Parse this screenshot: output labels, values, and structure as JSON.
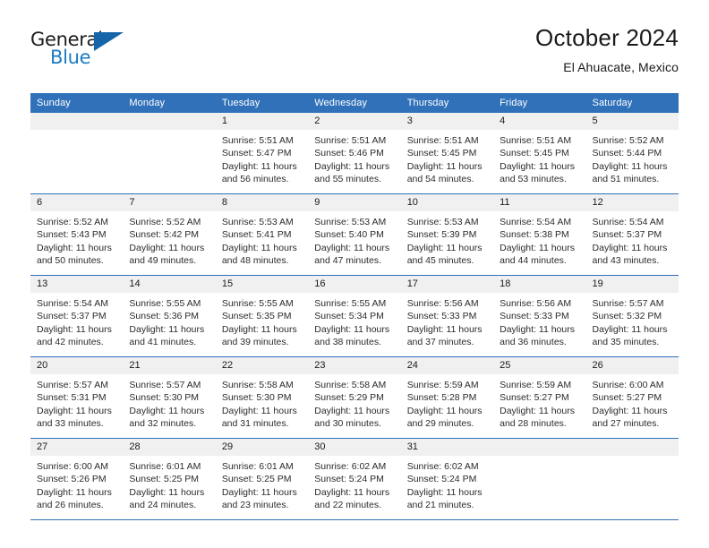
{
  "brand": {
    "name_top": "General",
    "name_bottom": "Blue",
    "triangle_color": "#1565a8",
    "blue_text_color": "#1d7cc4"
  },
  "header": {
    "title": "October 2024",
    "subtitle": "El Ahuacate, Mexico"
  },
  "theme": {
    "header_blue": "#3071b9",
    "date_band_gray": "#f0f0f0",
    "row_separator": "#3071b9",
    "text": "#1a1a1a"
  },
  "calendar": {
    "weekday_headers": [
      "Sunday",
      "Monday",
      "Tuesday",
      "Wednesday",
      "Thursday",
      "Friday",
      "Saturday"
    ],
    "labels": {
      "sunrise": "Sunrise:",
      "sunset": "Sunset:",
      "daylight": "Daylight:"
    },
    "weeks": [
      [
        {
          "day": "",
          "sunrise": "",
          "sunset": "",
          "daylight_line1": "",
          "daylight_line2": ""
        },
        {
          "day": "",
          "sunrise": "",
          "sunset": "",
          "daylight_line1": "",
          "daylight_line2": ""
        },
        {
          "day": "1",
          "sunrise": "Sunrise: 5:51 AM",
          "sunset": "Sunset: 5:47 PM",
          "daylight_line1": "Daylight: 11 hours",
          "daylight_line2": "and 56 minutes."
        },
        {
          "day": "2",
          "sunrise": "Sunrise: 5:51 AM",
          "sunset": "Sunset: 5:46 PM",
          "daylight_line1": "Daylight: 11 hours",
          "daylight_line2": "and 55 minutes."
        },
        {
          "day": "3",
          "sunrise": "Sunrise: 5:51 AM",
          "sunset": "Sunset: 5:45 PM",
          "daylight_line1": "Daylight: 11 hours",
          "daylight_line2": "and 54 minutes."
        },
        {
          "day": "4",
          "sunrise": "Sunrise: 5:51 AM",
          "sunset": "Sunset: 5:45 PM",
          "daylight_line1": "Daylight: 11 hours",
          "daylight_line2": "and 53 minutes."
        },
        {
          "day": "5",
          "sunrise": "Sunrise: 5:52 AM",
          "sunset": "Sunset: 5:44 PM",
          "daylight_line1": "Daylight: 11 hours",
          "daylight_line2": "and 51 minutes."
        }
      ],
      [
        {
          "day": "6",
          "sunrise": "Sunrise: 5:52 AM",
          "sunset": "Sunset: 5:43 PM",
          "daylight_line1": "Daylight: 11 hours",
          "daylight_line2": "and 50 minutes."
        },
        {
          "day": "7",
          "sunrise": "Sunrise: 5:52 AM",
          "sunset": "Sunset: 5:42 PM",
          "daylight_line1": "Daylight: 11 hours",
          "daylight_line2": "and 49 minutes."
        },
        {
          "day": "8",
          "sunrise": "Sunrise: 5:53 AM",
          "sunset": "Sunset: 5:41 PM",
          "daylight_line1": "Daylight: 11 hours",
          "daylight_line2": "and 48 minutes."
        },
        {
          "day": "9",
          "sunrise": "Sunrise: 5:53 AM",
          "sunset": "Sunset: 5:40 PM",
          "daylight_line1": "Daylight: 11 hours",
          "daylight_line2": "and 47 minutes."
        },
        {
          "day": "10",
          "sunrise": "Sunrise: 5:53 AM",
          "sunset": "Sunset: 5:39 PM",
          "daylight_line1": "Daylight: 11 hours",
          "daylight_line2": "and 45 minutes."
        },
        {
          "day": "11",
          "sunrise": "Sunrise: 5:54 AM",
          "sunset": "Sunset: 5:38 PM",
          "daylight_line1": "Daylight: 11 hours",
          "daylight_line2": "and 44 minutes."
        },
        {
          "day": "12",
          "sunrise": "Sunrise: 5:54 AM",
          "sunset": "Sunset: 5:37 PM",
          "daylight_line1": "Daylight: 11 hours",
          "daylight_line2": "and 43 minutes."
        }
      ],
      [
        {
          "day": "13",
          "sunrise": "Sunrise: 5:54 AM",
          "sunset": "Sunset: 5:37 PM",
          "daylight_line1": "Daylight: 11 hours",
          "daylight_line2": "and 42 minutes."
        },
        {
          "day": "14",
          "sunrise": "Sunrise: 5:55 AM",
          "sunset": "Sunset: 5:36 PM",
          "daylight_line1": "Daylight: 11 hours",
          "daylight_line2": "and 41 minutes."
        },
        {
          "day": "15",
          "sunrise": "Sunrise: 5:55 AM",
          "sunset": "Sunset: 5:35 PM",
          "daylight_line1": "Daylight: 11 hours",
          "daylight_line2": "and 39 minutes."
        },
        {
          "day": "16",
          "sunrise": "Sunrise: 5:55 AM",
          "sunset": "Sunset: 5:34 PM",
          "daylight_line1": "Daylight: 11 hours",
          "daylight_line2": "and 38 minutes."
        },
        {
          "day": "17",
          "sunrise": "Sunrise: 5:56 AM",
          "sunset": "Sunset: 5:33 PM",
          "daylight_line1": "Daylight: 11 hours",
          "daylight_line2": "and 37 minutes."
        },
        {
          "day": "18",
          "sunrise": "Sunrise: 5:56 AM",
          "sunset": "Sunset: 5:33 PM",
          "daylight_line1": "Daylight: 11 hours",
          "daylight_line2": "and 36 minutes."
        },
        {
          "day": "19",
          "sunrise": "Sunrise: 5:57 AM",
          "sunset": "Sunset: 5:32 PM",
          "daylight_line1": "Daylight: 11 hours",
          "daylight_line2": "and 35 minutes."
        }
      ],
      [
        {
          "day": "20",
          "sunrise": "Sunrise: 5:57 AM",
          "sunset": "Sunset: 5:31 PM",
          "daylight_line1": "Daylight: 11 hours",
          "daylight_line2": "and 33 minutes."
        },
        {
          "day": "21",
          "sunrise": "Sunrise: 5:57 AM",
          "sunset": "Sunset: 5:30 PM",
          "daylight_line1": "Daylight: 11 hours",
          "daylight_line2": "and 32 minutes."
        },
        {
          "day": "22",
          "sunrise": "Sunrise: 5:58 AM",
          "sunset": "Sunset: 5:30 PM",
          "daylight_line1": "Daylight: 11 hours",
          "daylight_line2": "and 31 minutes."
        },
        {
          "day": "23",
          "sunrise": "Sunrise: 5:58 AM",
          "sunset": "Sunset: 5:29 PM",
          "daylight_line1": "Daylight: 11 hours",
          "daylight_line2": "and 30 minutes."
        },
        {
          "day": "24",
          "sunrise": "Sunrise: 5:59 AM",
          "sunset": "Sunset: 5:28 PM",
          "daylight_line1": "Daylight: 11 hours",
          "daylight_line2": "and 29 minutes."
        },
        {
          "day": "25",
          "sunrise": "Sunrise: 5:59 AM",
          "sunset": "Sunset: 5:27 PM",
          "daylight_line1": "Daylight: 11 hours",
          "daylight_line2": "and 28 minutes."
        },
        {
          "day": "26",
          "sunrise": "Sunrise: 6:00 AM",
          "sunset": "Sunset: 5:27 PM",
          "daylight_line1": "Daylight: 11 hours",
          "daylight_line2": "and 27 minutes."
        }
      ],
      [
        {
          "day": "27",
          "sunrise": "Sunrise: 6:00 AM",
          "sunset": "Sunset: 5:26 PM",
          "daylight_line1": "Daylight: 11 hours",
          "daylight_line2": "and 26 minutes."
        },
        {
          "day": "28",
          "sunrise": "Sunrise: 6:01 AM",
          "sunset": "Sunset: 5:25 PM",
          "daylight_line1": "Daylight: 11 hours",
          "daylight_line2": "and 24 minutes."
        },
        {
          "day": "29",
          "sunrise": "Sunrise: 6:01 AM",
          "sunset": "Sunset: 5:25 PM",
          "daylight_line1": "Daylight: 11 hours",
          "daylight_line2": "and 23 minutes."
        },
        {
          "day": "30",
          "sunrise": "Sunrise: 6:02 AM",
          "sunset": "Sunset: 5:24 PM",
          "daylight_line1": "Daylight: 11 hours",
          "daylight_line2": "and 22 minutes."
        },
        {
          "day": "31",
          "sunrise": "Sunrise: 6:02 AM",
          "sunset": "Sunset: 5:24 PM",
          "daylight_line1": "Daylight: 11 hours",
          "daylight_line2": "and 21 minutes."
        },
        {
          "day": "",
          "sunrise": "",
          "sunset": "",
          "daylight_line1": "",
          "daylight_line2": ""
        },
        {
          "day": "",
          "sunrise": "",
          "sunset": "",
          "daylight_line1": "",
          "daylight_line2": ""
        }
      ]
    ]
  }
}
